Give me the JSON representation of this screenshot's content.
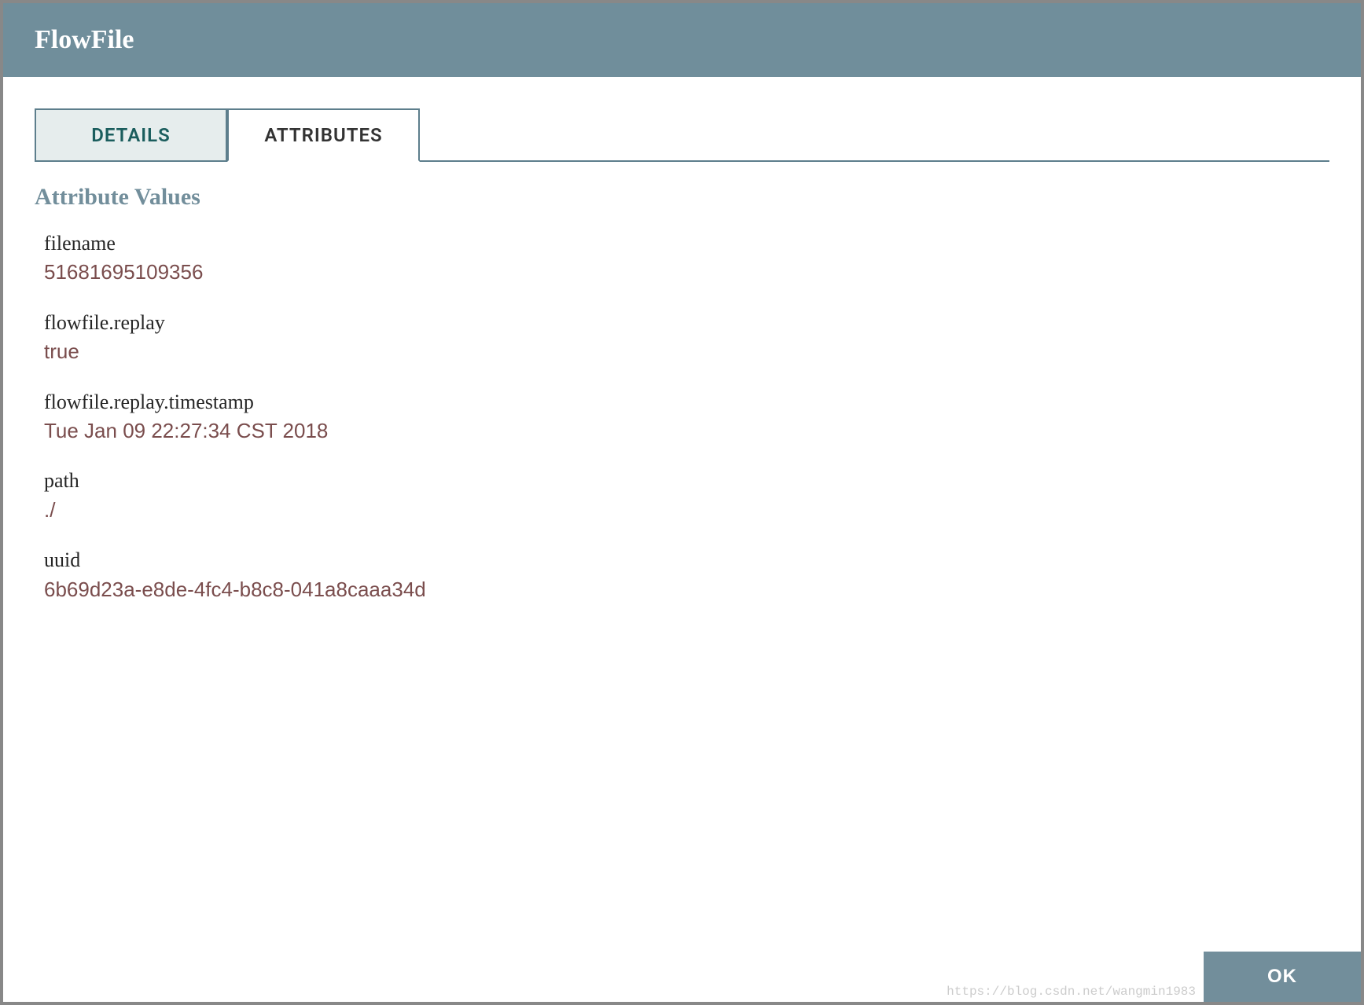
{
  "header": {
    "title": "FlowFile"
  },
  "tabs": {
    "details": "DETAILS",
    "attributes": "ATTRIBUTES"
  },
  "section": {
    "title": "Attribute Values"
  },
  "attributes": [
    {
      "key": "filename",
      "value": "51681695109356"
    },
    {
      "key": "flowfile.replay",
      "value": "true"
    },
    {
      "key": "flowfile.replay.timestamp",
      "value": "Tue Jan 09 22:27:34 CST 2018"
    },
    {
      "key": "path",
      "value": "./"
    },
    {
      "key": "uuid",
      "value": "6b69d23a-e8de-4fc4-b8c8-041a8caaa34d"
    }
  ],
  "footer": {
    "ok": "OK"
  },
  "watermark": "https://blog.csdn.net/wangmin1983"
}
